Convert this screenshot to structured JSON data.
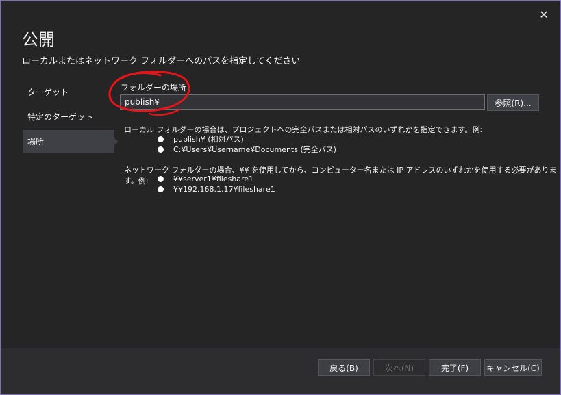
{
  "dialog": {
    "title": "公開",
    "subtitle": "ローカルまたはネットワーク フォルダーへのパスを指定してください",
    "close_glyph": "✕"
  },
  "nav": {
    "items": [
      {
        "label": "ターゲット"
      },
      {
        "label": "特定のターゲット"
      },
      {
        "label": "場所"
      }
    ]
  },
  "folder": {
    "label": "フォルダーの場所",
    "value": "publish¥",
    "browse_label": "参照(R)..."
  },
  "help": {
    "local_desc": "ローカル フォルダーの場合は、プロジェクトへの完全パスまたは相対パスのいずれかを指定できます。例:",
    "local_examples": [
      "publish¥ (相対パス)",
      "C:¥Users¥Username¥Documents (完全パス)"
    ],
    "network_desc": "ネットワーク フォルダーの場合、¥¥ を使用してから、コンピューター名または IP アドレスのいずれかを使用する必要があります。例:",
    "network_examples": [
      "¥¥server1¥fileshare1",
      "¥¥192.168.1.17¥fileshare1"
    ]
  },
  "footer": {
    "back_label": "戻る(B)",
    "next_label": "次へ(N)",
    "finish_label": "完了(F)",
    "cancel_label": "キャンセル(C)"
  },
  "colors": {
    "background": "#252526",
    "border_accent": "#7e6fb8",
    "annotation_red": "#e5141b"
  }
}
